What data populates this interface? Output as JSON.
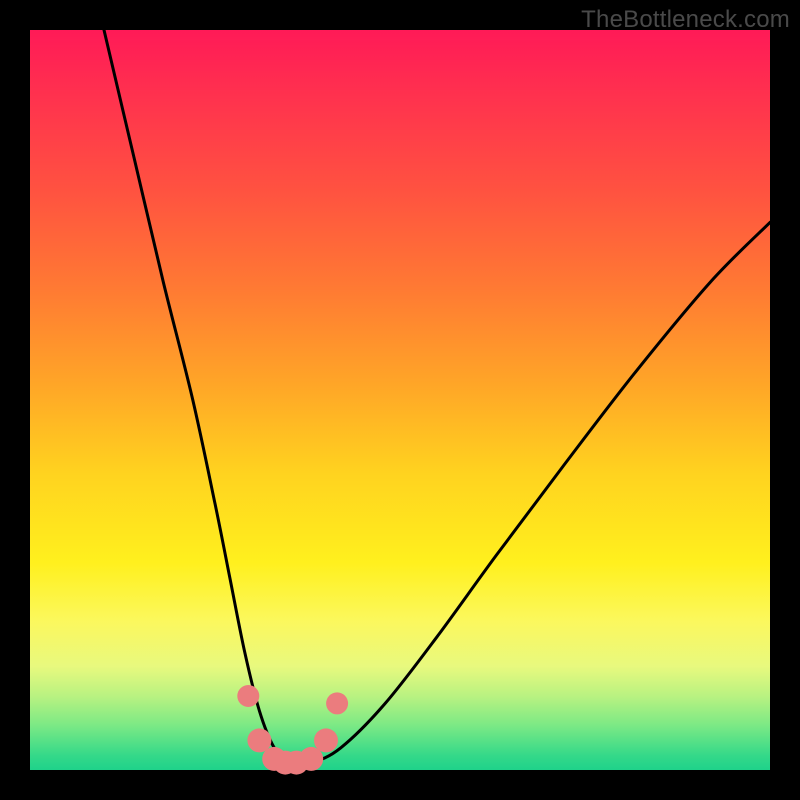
{
  "watermark": "TheBottleneck.com",
  "chart_data": {
    "type": "line",
    "title": "",
    "xlabel": "",
    "ylabel": "",
    "xlim": [
      0,
      100
    ],
    "ylim": [
      0,
      100
    ],
    "grid": false,
    "legend": false,
    "series": [
      {
        "name": "bottleneck-curve",
        "x": [
          10,
          14,
          18,
          22,
          25,
          27,
          29,
          31,
          33,
          35,
          38,
          42,
          48,
          55,
          63,
          72,
          82,
          92,
          100
        ],
        "y": [
          100,
          83,
          66,
          50,
          36,
          26,
          16,
          8,
          3,
          1,
          1,
          3,
          9,
          18,
          29,
          41,
          54,
          66,
          74
        ]
      },
      {
        "name": "bottleneck-highlight-dots",
        "x": [
          29.5,
          31,
          33,
          34.5,
          36,
          38,
          40,
          41.5
        ],
        "y": [
          10,
          4,
          1.5,
          1,
          1,
          1.5,
          4,
          9
        ]
      }
    ],
    "annotations": []
  },
  "colors": {
    "curve": "#000000",
    "dots": "#eb7c7e",
    "frame": "#000000"
  }
}
